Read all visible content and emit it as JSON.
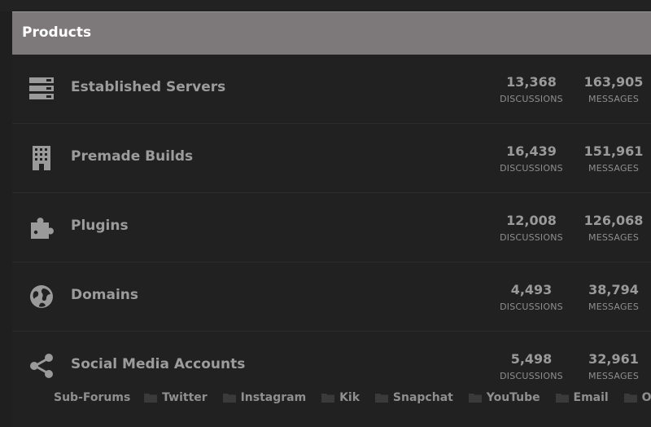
{
  "header": {
    "title": "Products"
  },
  "colors": {
    "header_bg": "#7d787a",
    "panel_bg": "#212121",
    "text_muted": "#9c9c9c",
    "icon": "#9a9a9a"
  },
  "stat_labels": {
    "discussions": "DISCUSSIONS",
    "messages": "MESSAGES"
  },
  "forums": [
    {
      "title": "Established Servers",
      "icon": "server-icon",
      "discussions": "13,368",
      "messages": "163,905"
    },
    {
      "title": "Premade Builds",
      "icon": "building-icon",
      "discussions": "16,439",
      "messages": "151,961"
    },
    {
      "title": "Plugins",
      "icon": "puzzle-icon",
      "discussions": "12,008",
      "messages": "126,068"
    },
    {
      "title": "Domains",
      "icon": "globe-icon",
      "discussions": "4,493",
      "messages": "38,794"
    },
    {
      "title": "Social Media Accounts",
      "icon": "share-icon",
      "discussions": "5,498",
      "messages": "32,961"
    }
  ],
  "subforums": {
    "label": "Sub-Forums",
    "icon": "folder-icon",
    "items": [
      "Twitter",
      "Instagram",
      "Kik",
      "Snapchat",
      "YouTube",
      "Email",
      "Other"
    ]
  }
}
